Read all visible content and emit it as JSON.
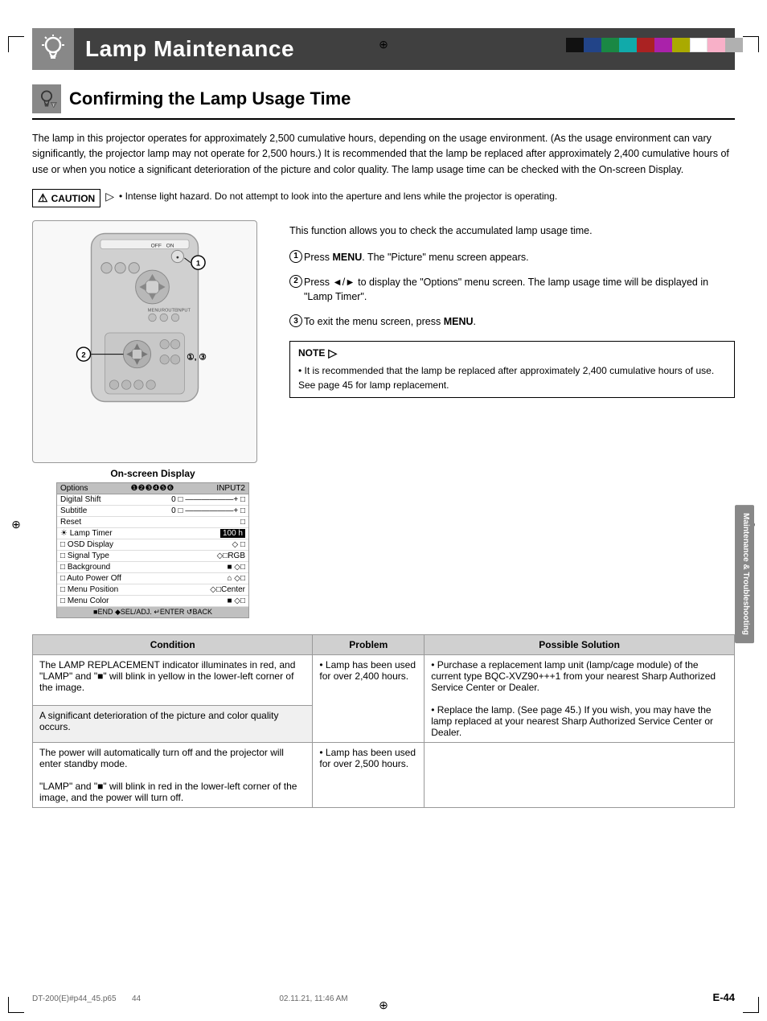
{
  "page": {
    "header": {
      "title": "Lamp Maintenance",
      "icon_label": "lamp-icon"
    },
    "section": {
      "title": "Confirming the Lamp Usage Time",
      "icon_label": "lamp-warning-icon"
    },
    "body_text": "The lamp in this projector operates for approximately 2,500 cumulative hours, depending on the usage environment. (As the usage environment can vary significantly, the projector lamp may not operate for 2,500 hours.) It is recommended that the lamp be replaced after approximately 2,400 cumulative hours of use or when you notice a significant deterioration of the picture and color quality. The lamp usage time can be checked with the On-screen Display.",
    "caution": {
      "label": "CAUTION",
      "text": "Intense light hazard. Do not attempt to look into the aperture and lens while the projector is operating."
    },
    "diagram_label": "On-screen Display",
    "description": "This function allows you to check the accumulated lamp usage time.",
    "steps": [
      {
        "num": "1",
        "text": "Press ",
        "bold": "MENU",
        "rest": ". The “Picture” menu screen appears."
      },
      {
        "num": "2",
        "text": "Press ◄/► to display the “Options” menu screen. The lamp usage time will be displayed in “Lamp Timer”."
      },
      {
        "num": "3",
        "text": "To exit the menu screen, press ",
        "bold": "MENU",
        "rest": "."
      }
    ],
    "note": {
      "label": "NOTE",
      "text": "It is recommended that the lamp be replaced after approximately 2,400 cumulative hours of use. See page 45 for lamp replacement."
    },
    "osd": {
      "header_left": "Options",
      "header_right": "INPUT2",
      "rows": [
        {
          "label": "Digital Shift",
          "value": "0 □ ——————+ □"
        },
        {
          "label": "Subtitle",
          "value": "0 □ ——————+ □"
        },
        {
          "label": "Reset",
          "value": "□"
        },
        {
          "label": "☀ Lamp Timer",
          "value": "100 h",
          "highlight": true
        },
        {
          "label": "□ OSD Display",
          "value": "◇ □"
        },
        {
          "label": "□ Signal Type",
          "value": "◇□RGB"
        },
        {
          "label": "□ Background",
          "value": "■ ◇□"
        },
        {
          "label": "□ Auto Power Off",
          "value": "⌂ ◇□"
        },
        {
          "label": "□ Menu Position",
          "value": "◇□Center"
        },
        {
          "label": "□ Menu Color",
          "value": "■ ◇□"
        }
      ],
      "footer": "■END ♦SEL/ADJ. ↵ENTER ↺BAck"
    },
    "table": {
      "headers": [
        "Condition",
        "Problem",
        "Possible Solution"
      ],
      "rows": [
        {
          "condition": "The LAMP REPLACEMENT indicator illuminates in red, and \"LAMP\" and \"■\" will blink in yellow in the lower-left corner of the image.",
          "problem": "• Lamp has been used for over 2,400 hours.",
          "solution": "• Purchase a replacement lamp unit (lamp/cage module) of the current type BQC-XVZ90+++1 from your nearest Sharp Authorized Service Center or Dealer.\n• Replace the lamp. (See page 45.) If you wish, you may have the lamp replaced at your nearest Sharp Authorized Service Center or Dealer.",
          "rowspan": 2
        },
        {
          "condition": "A significant deterioration of the picture and color quality occurs.",
          "problem": "",
          "solution": ""
        },
        {
          "condition": "The power will automatically turn off and the projector will enter standby mode.\n\"LAMP\" and \"■\" will blink in red in the lower-left corner of the image, and the power will turn off.",
          "problem": "• Lamp has been used for over 2,500 hours.",
          "solution": ""
        }
      ]
    },
    "sidebar_tab": "Maintenance &\nTroubleshooting",
    "page_number": "E-44",
    "footer_left": "DT-200(E)#p44_45.p65",
    "footer_center": "44",
    "footer_right": "02.11.21, 11:46 AM",
    "colors": {
      "header_bg": "#404040",
      "section_underline": "#000000",
      "caution_border": "#000000",
      "note_border": "#000000",
      "table_header_bg": "#c8c8c8",
      "sidebar_bg": "#888888",
      "color_bar": [
        "#000",
        "#2255aa",
        "#22aa22",
        "#22aaaa",
        "#cc2222",
        "#cc22aa",
        "#cccc22",
        "#fff",
        "#f8a0c0",
        "#a0a0a0"
      ]
    }
  }
}
